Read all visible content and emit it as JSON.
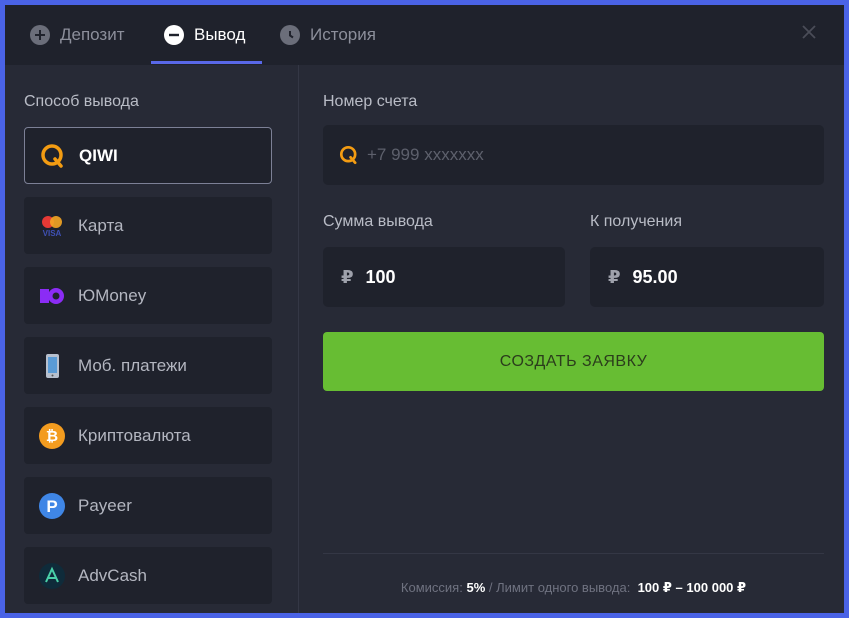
{
  "tabs": [
    {
      "label": "Депозит",
      "icon": "plus-circle-icon",
      "active": false
    },
    {
      "label": "Вывод",
      "icon": "minus-circle-icon",
      "active": true
    },
    {
      "label": "История",
      "icon": "clock-icon",
      "active": false
    }
  ],
  "close_icon": "close-icon",
  "left": {
    "title": "Способ вывода",
    "methods": [
      {
        "label": "QIWI",
        "icon": "qiwi-icon",
        "selected": true
      },
      {
        "label": "Карта",
        "icon": "card-icon",
        "selected": false
      },
      {
        "label": "ЮMoney",
        "icon": "yoomoney-icon",
        "selected": false
      },
      {
        "label": "Моб. платежи",
        "icon": "phone-icon",
        "selected": false
      },
      {
        "label": "Криптовалюта",
        "icon": "bitcoin-icon",
        "selected": false
      },
      {
        "label": "Payeer",
        "icon": "payeer-icon",
        "selected": false
      },
      {
        "label": "AdvCash",
        "icon": "advcash-icon",
        "selected": false
      }
    ]
  },
  "form": {
    "account_label": "Номер счета",
    "account_placeholder": "+7 999 xxxxxxx",
    "amount_label": "Сумма вывода",
    "amount_value": "100",
    "receive_label": "К получения",
    "receive_value": "95.00",
    "currency_symbol": "₽",
    "submit_label": "СОЗДАТЬ ЗАЯВКУ"
  },
  "footer": {
    "commission_label": "Комиссия:",
    "commission_value": "5%",
    "separator": "/",
    "limit_label": "Лимит одного вывода:",
    "limit_min": "100 ₽",
    "limit_dash": "–",
    "limit_max": "100 000 ₽"
  },
  "colors": {
    "accent": "#5968e8",
    "submit": "#67bd33",
    "background": "#272a36",
    "panel": "#1f222c",
    "frame": "#4a63e6"
  }
}
